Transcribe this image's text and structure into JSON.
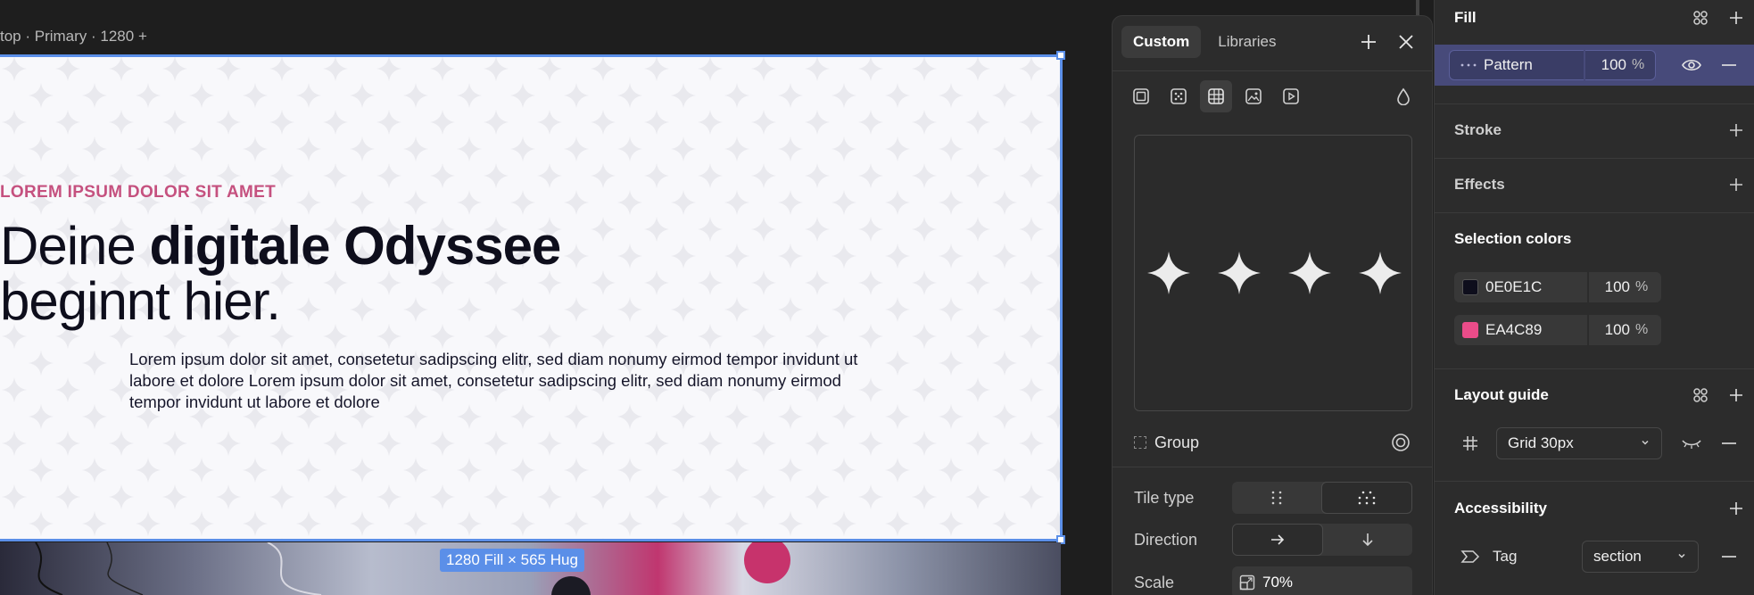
{
  "canvas": {
    "frame_label": "top · Primary · 1280 +",
    "size_badge": "1280 Fill × 565 Hug",
    "hero": {
      "eyebrow": "LOREM IPSUM DOLOR SIT AMET",
      "headline_regular": "Deine ",
      "headline_bold": "digitale Odyssee",
      "headline_line2": "beginnt hier.",
      "body": "Lorem ipsum dolor sit amet, consetetur sadipscing elitr, sed diam nonumy eirmod tempor invidunt ut labore et dolore Lorem ipsum dolor sit amet, consetetur sadipscing elitr, sed diam nonumy eirmod tempor invidunt ut labore et dolore"
    },
    "colors": {
      "eyebrow": "#C5517F",
      "headline": "#0E0E1C",
      "selection": "#5B8FE8"
    }
  },
  "popover": {
    "tabs": [
      {
        "label": "Custom",
        "active": true
      },
      {
        "label": "Libraries",
        "active": false
      }
    ],
    "fill_types": [
      {
        "icon": "solid-fill-icon"
      },
      {
        "icon": "gradient-fill-icon"
      },
      {
        "icon": "pattern-fill-icon",
        "active": true
      },
      {
        "icon": "image-fill-icon"
      },
      {
        "icon": "video-fill-icon"
      }
    ],
    "group_label": "Group",
    "tile_type_label": "Tile type",
    "direction_label": "Direction",
    "scale_label": "Scale",
    "scale_value": "70%"
  },
  "panel": {
    "fill": {
      "title": "Fill",
      "layer_name": "Pattern",
      "opacity": "100",
      "pct": "%"
    },
    "stroke_title": "Stroke",
    "effects_title": "Effects",
    "selection_colors": {
      "title": "Selection colors",
      "items": [
        {
          "hex": "0E0E1C",
          "opacity": "100",
          "pct": "%",
          "color": "#0E0E1C"
        },
        {
          "hex": "EA4C89",
          "opacity": "100",
          "pct": "%",
          "color": "#EA4C89"
        }
      ]
    },
    "layout_guide": {
      "title": "Layout guide",
      "value": "Grid 30px"
    },
    "accessibility": {
      "title": "Accessibility",
      "tag_label": "Tag",
      "tag_value": "section"
    }
  }
}
